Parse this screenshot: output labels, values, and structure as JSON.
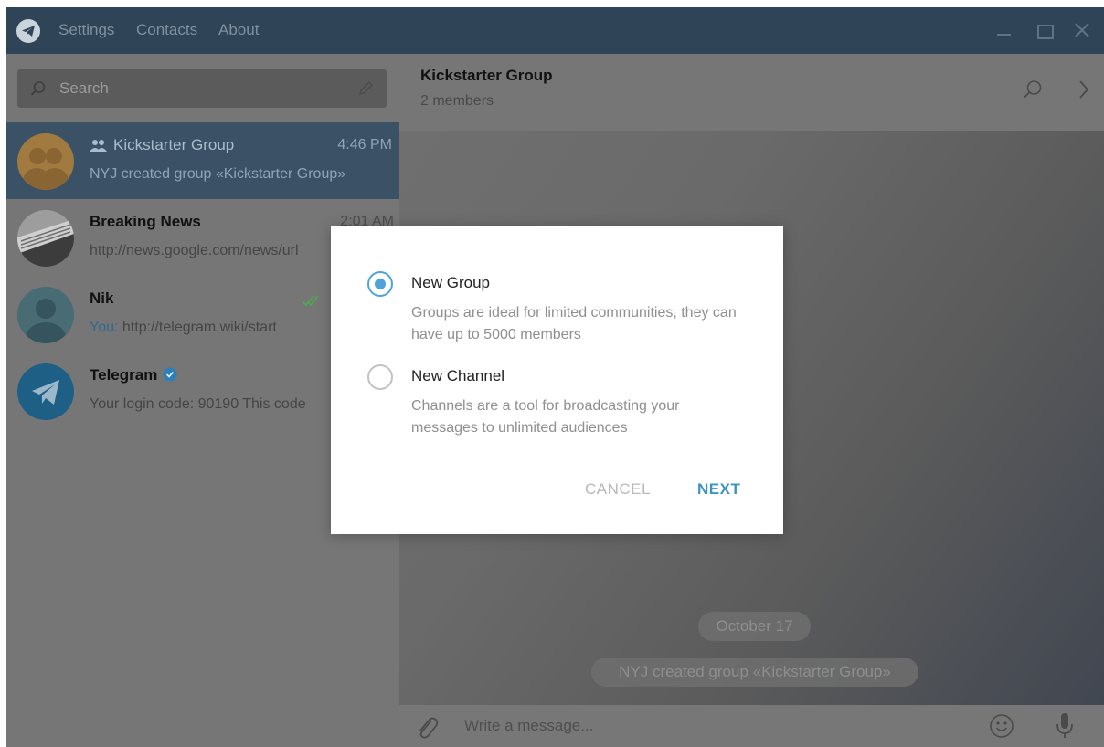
{
  "menu": {
    "settings": "Settings",
    "contacts": "Contacts",
    "about": "About"
  },
  "search": {
    "placeholder": "Search"
  },
  "chats": [
    {
      "name": "Kickstarter Group",
      "time": "4:46 PM",
      "preview": "NYJ created group «Kickstarter Group»",
      "icon": "group-icon"
    },
    {
      "name": "Breaking News",
      "time": "2:01 AM",
      "preview": "http://news.google.com/news/url"
    },
    {
      "name": "Nik",
      "time": "",
      "preview_prefix": "You:",
      "preview": "http://telegram.wiki/start",
      "status": "double-check-icon"
    },
    {
      "name": "Telegram",
      "time": "",
      "preview": "Your login code: 90190  This code",
      "badge": "verified-icon"
    }
  ],
  "chat_header": {
    "title": "Kickstarter Group",
    "subtitle": "2 members"
  },
  "messages": {
    "date": "October 17",
    "service": "NYJ created group «Kickstarter Group»"
  },
  "compose": {
    "placeholder": "Write a message..."
  },
  "dialog": {
    "options": [
      {
        "title": "New Group",
        "description": "Groups are ideal for limited communities, they can have up to 5000 members",
        "selected": true
      },
      {
        "title": "New Channel",
        "description": "Channels are a tool for broadcasting your messages to unlimited audiences",
        "selected": false
      }
    ],
    "cancel": "CANCEL",
    "next": "NEXT"
  },
  "colors": {
    "accent": "#4ea4d9",
    "titlebar": "#2f4457",
    "active_chat": "#3b5266",
    "check_green": "#4cae4c"
  }
}
